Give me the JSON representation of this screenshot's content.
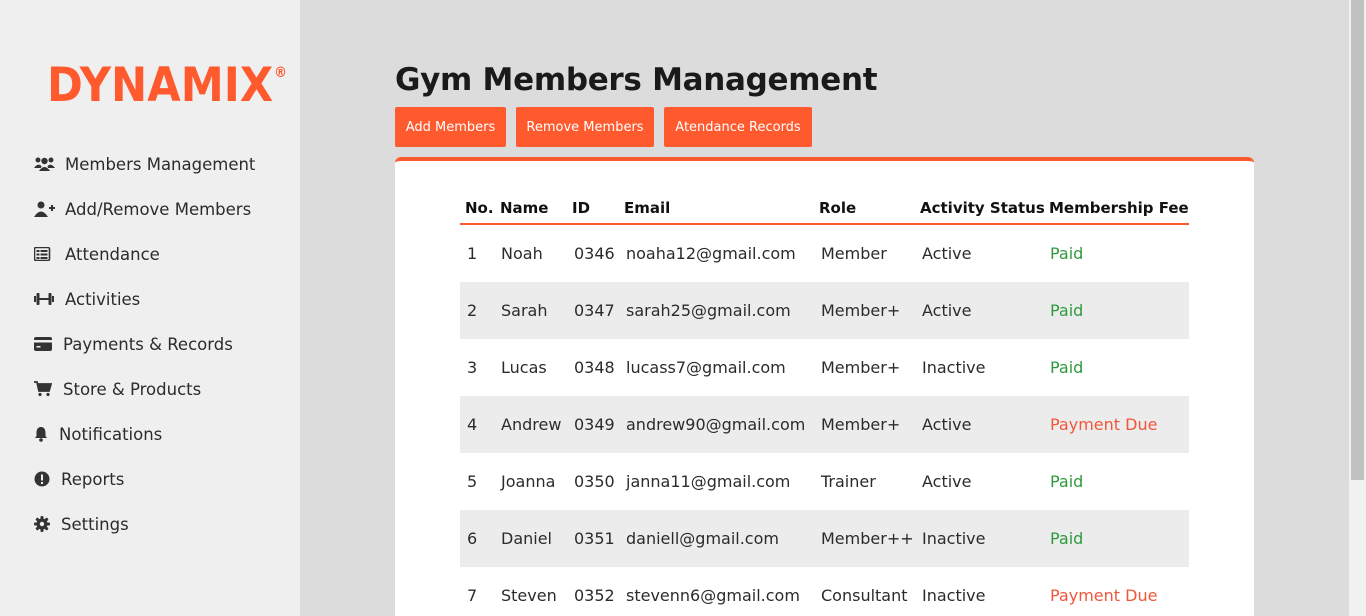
{
  "brand": {
    "logo": "DYNAMIX",
    "mark": "®"
  },
  "sidebar": {
    "items": [
      {
        "label": "Members Management",
        "icon": "users-icon"
      },
      {
        "label": "Add/Remove Members",
        "icon": "user-plus-icon"
      },
      {
        "label": "Attendance",
        "icon": "table-list-icon"
      },
      {
        "label": "Activities",
        "icon": "dumbbell-icon"
      },
      {
        "label": "Payments & Records",
        "icon": "credit-card-icon"
      },
      {
        "label": "Store & Products",
        "icon": "cart-icon"
      },
      {
        "label": "Notifications",
        "icon": "bell-icon"
      },
      {
        "label": "Reports",
        "icon": "exclamation-circle-icon"
      },
      {
        "label": "Settings",
        "icon": "gear-icon"
      }
    ]
  },
  "main": {
    "title": "Gym Members Management",
    "buttons": {
      "add": "Add Members",
      "remove": "Remove Members",
      "attendance": "Atendance Records"
    }
  },
  "table": {
    "headers": [
      "No.",
      "Name",
      "ID",
      "Email",
      "Role",
      "Activity Status",
      "Membership Fee"
    ],
    "rows": [
      {
        "no": "1",
        "name": "Noah",
        "id": "0346",
        "email": "noaha12@gmail.com",
        "role": "Member",
        "status": "Active",
        "fee": "Paid"
      },
      {
        "no": "2",
        "name": "Sarah",
        "id": "0347",
        "email": "sarah25@gmail.com",
        "role": "Member+",
        "status": "Active",
        "fee": "Paid"
      },
      {
        "no": "3",
        "name": "Lucas",
        "id": "0348",
        "email": "lucass7@gmail.com",
        "role": "Member+",
        "status": "Inactive",
        "fee": "Paid"
      },
      {
        "no": "4",
        "name": "Andrew",
        "id": "0349",
        "email": "andrew90@gmail.com",
        "role": "Member+",
        "status": "Active",
        "fee": "Payment Due"
      },
      {
        "no": "5",
        "name": "Joanna",
        "id": "0350",
        "email": "janna11@gmail.com",
        "role": "Trainer",
        "status": "Active",
        "fee": "Paid"
      },
      {
        "no": "6",
        "name": "Daniel",
        "id": "0351",
        "email": "daniell@gmail.com",
        "role": "Member++",
        "status": "Inactive",
        "fee": "Paid"
      },
      {
        "no": "7",
        "name": "Steven",
        "id": "0352",
        "email": "stevenn6@gmail.com",
        "role": "Consultant",
        "status": "Inactive",
        "fee": "Payment Due"
      }
    ]
  },
  "colors": {
    "accent": "#ff5a2e",
    "paid": "#2e9a3d",
    "due": "#f0573a"
  }
}
